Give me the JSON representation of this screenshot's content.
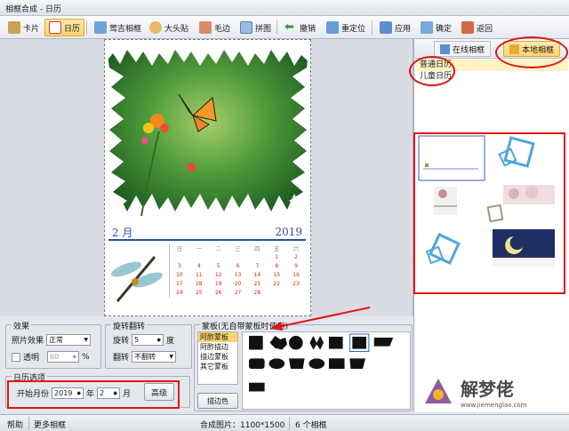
{
  "window": {
    "title": "相框合成 - 日历"
  },
  "toolbar": {
    "card": "卡片",
    "calendar": "日历",
    "auspicious_frame": "莺吉相框",
    "sticker": "大头贴",
    "border": "毛边",
    "collage": "拼图",
    "undo": "撤销",
    "reset_position": "重定位",
    "apply": "应用",
    "confirm": "确定",
    "back": "返回"
  },
  "calendar_preview": {
    "month": "2 月",
    "year": "2019",
    "weekdays": [
      "日",
      "一",
      "二",
      "三",
      "四",
      "五",
      "六"
    ],
    "weeks": [
      [
        "",
        "",
        "",
        "",
        "",
        "1",
        "2"
      ],
      [
        "3",
        "4",
        "5",
        "6",
        "7",
        "8",
        "9"
      ],
      [
        "10",
        "11",
        "12",
        "13",
        "14",
        "15",
        "16"
      ],
      [
        "17",
        "18",
        "19",
        "20",
        "21",
        "22",
        "23"
      ],
      [
        "24",
        "25",
        "26",
        "27",
        "28",
        "",
        ""
      ]
    ]
  },
  "right_panel": {
    "tabs": {
      "online": "在线相框",
      "local": "本地相框"
    },
    "frame_list": [
      "普通日历",
      "儿童日历"
    ],
    "selected_index": 0
  },
  "effects": {
    "group_label": "效果",
    "photo_effect_label": "照片效果",
    "photo_effect_value": "正常",
    "transparent_label": "透明",
    "transparent_value": "60",
    "percent": "%"
  },
  "rotate": {
    "group_label": "旋转翻转",
    "rotate_label": "旋转",
    "rotate_value": "5",
    "degree": "度",
    "flip_label": "翻转",
    "flip_value": "不翻转"
  },
  "calendar_options": {
    "group_label": "日历选项",
    "start_month_label": "开始月份",
    "year_value": "2019",
    "year_unit": "年",
    "month_value": "2",
    "month_unit": "月",
    "advanced": "高级"
  },
  "mask": {
    "group_label": "蒙板(无自带蒙板时使用)",
    "items": [
      "阿酢蒙板",
      "阿酢描边",
      "描边蒙板",
      "其它蒙板"
    ],
    "selected_index": 0,
    "stroke_color": "描边色"
  },
  "status": {
    "help": "帮助",
    "more_frames": "更多相框",
    "composite": "合成图片：1100*1500",
    "frame_count": "6 个相框"
  },
  "watermark": {
    "name": "解梦佬",
    "url": "www.jiemenglao.com"
  },
  "colors": {
    "accent": "#2b4f9e",
    "highlight": "#ffd46b",
    "annotation": "#e01515",
    "weekend": "#d62020"
  }
}
